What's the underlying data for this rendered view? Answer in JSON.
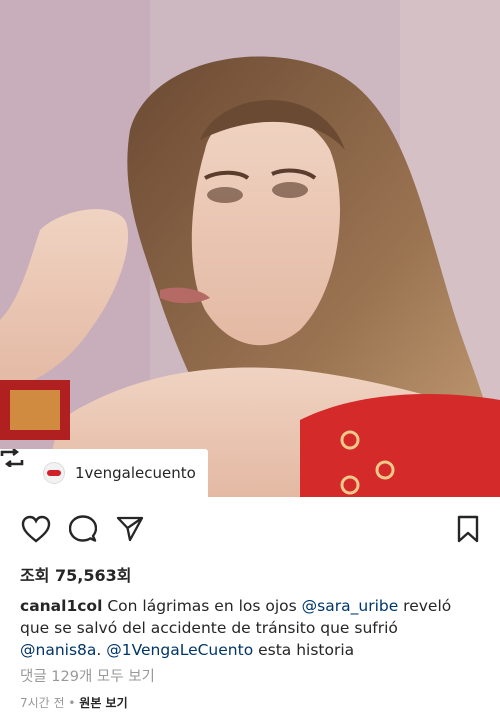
{
  "post": {
    "regram_username": "1vengalecuento",
    "views_label": "조회 75,563회",
    "author": "canal1col",
    "caption_parts": [
      {
        "text": "Con lágrimas en los ojos ",
        "type": "text"
      },
      {
        "text": "@sara_uribe",
        "type": "mention"
      },
      {
        "text": " reveló que se salvó del accidente de tránsito que sufrió ",
        "type": "text"
      },
      {
        "text": "@nanis8a",
        "type": "mention"
      },
      {
        "text": ". ",
        "type": "text"
      },
      {
        "text": "@1VengaLeCuento",
        "type": "mention"
      },
      {
        "text": " esta historia",
        "type": "text"
      }
    ],
    "comments_label": "댓글 129개 모두 보기",
    "time_label": "7시간 전",
    "separator": " • ",
    "original_label": "원본 보기"
  },
  "icons": {
    "regram": "regram-icon",
    "like": "heart-icon",
    "comment": "comment-icon",
    "share": "send-icon",
    "save": "bookmark-icon"
  },
  "colors": {
    "text": "#262626",
    "secondary": "#999999",
    "mention": "#003569",
    "dress_red": "#d42a2a"
  }
}
